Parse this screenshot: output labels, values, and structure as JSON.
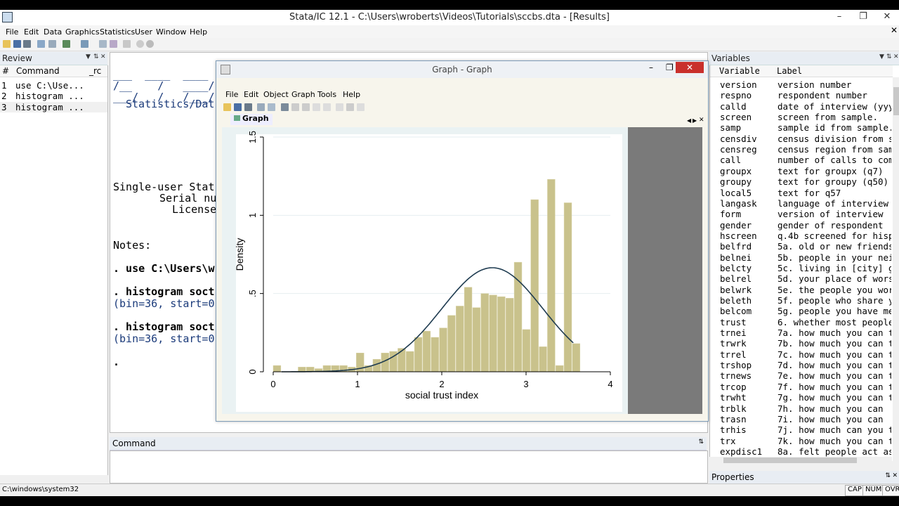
{
  "window": {
    "title": "Stata/IC 12.1 - C:\\Users\\wroberts\\Videos\\Tutorials\\sccbs.dta - [Results]"
  },
  "menu": [
    "File",
    "Edit",
    "Data",
    "Graphics",
    "Statistics",
    "User",
    "Window",
    "Help"
  ],
  "review": {
    "title": "Review",
    "columns": [
      "#",
      "Command",
      "_rc"
    ],
    "rows": [
      {
        "n": "1",
        "cmd": "use C:\\Use..."
      },
      {
        "n": "2",
        "cmd": "histogram ..."
      },
      {
        "n": "3",
        "cmd": "histogram ..."
      }
    ]
  },
  "results": {
    "logo1": "___  ____  ____",
    "logo2": "/__    /   ____/",
    "logo3": "___/   /   /___/",
    "stats_line": "Statistics/Dat",
    "single_user": "Single-user Stat",
    "serial": "Serial nu",
    "license": "License",
    "notes": "Notes:",
    "use_cmd": ". use C:\\Users\\w",
    "hist1": ". histogram soct",
    "bin1": "(bin=36, start=0",
    "hist2": ". histogram soct",
    "bin2": "(bin=36, start=0",
    "prompt": "."
  },
  "command": {
    "title": "Command"
  },
  "variables": {
    "title": "Variables",
    "columns": [
      "Variable",
      "Label"
    ],
    "rows": [
      {
        "name": "version",
        "label": "version number"
      },
      {
        "name": "respno",
        "label": "respondent number"
      },
      {
        "name": "calld",
        "label": "date of interview (yyy"
      },
      {
        "name": "screen",
        "label": "screen from sample."
      },
      {
        "name": "samp",
        "label": "sample id from sample."
      },
      {
        "name": "censdiv",
        "label": "census division from s"
      },
      {
        "name": "censreg",
        "label": "census region from sam"
      },
      {
        "name": "call",
        "label": "number of calls to com"
      },
      {
        "name": "groupx",
        "label": "text for groupx (q7)"
      },
      {
        "name": "groupy",
        "label": "text for groupy (q50)"
      },
      {
        "name": "local5",
        "label": "text for q57"
      },
      {
        "name": "langask",
        "label": "language of interview"
      },
      {
        "name": "form",
        "label": "version of interview"
      },
      {
        "name": "gender",
        "label": "gender of respondent"
      },
      {
        "name": "hscreen",
        "label": "q.4b screened for hisp"
      },
      {
        "name": "belfrd",
        "label": "5a. old or new friends"
      },
      {
        "name": "belnei",
        "label": "5b. people in your nei"
      },
      {
        "name": "belcty",
        "label": "5c. living in [city] g"
      },
      {
        "name": "belrel",
        "label": "5d. your place of wors"
      },
      {
        "name": "belwrk",
        "label": "5e. the people you wor"
      },
      {
        "name": "beleth",
        "label": "5f. people who share y"
      },
      {
        "name": "belcom",
        "label": "5g. people you have me"
      },
      {
        "name": "trust",
        "label": "6. whether most people"
      },
      {
        "name": "trnei",
        "label": "7a. how much you can t"
      },
      {
        "name": "trwrk",
        "label": "7b. how much you can t"
      },
      {
        "name": "trrel",
        "label": "7c. how much you can t"
      },
      {
        "name": "trshop",
        "label": "7d. how much you can t"
      },
      {
        "name": "trnews",
        "label": "7e. how much you can t"
      },
      {
        "name": "trcop",
        "label": "7f. how much you can t"
      },
      {
        "name": "trwht",
        "label": "7g. how much you can t"
      },
      {
        "name": "trblk",
        "label": "7h. how much  you can"
      },
      {
        "name": "trasn",
        "label": "7i. how much  you can"
      },
      {
        "name": "trhis",
        "label": "7j. how much can you t"
      },
      {
        "name": "trx",
        "label": "7k. how much you can t"
      },
      {
        "name": "expdisc1",
        "label": "8a. felt people act as"
      }
    ]
  },
  "properties": {
    "title": "Properties"
  },
  "status": {
    "path": "C:\\windows\\system32",
    "caps": "CAP",
    "num": "NUM",
    "ovr": "OVR"
  },
  "graph_window": {
    "title": "Graph - Graph",
    "menu": [
      "File",
      "Edit",
      "Object",
      "Graph",
      "Tools",
      "Help"
    ],
    "tab": "Graph"
  },
  "chart_data": {
    "type": "bar",
    "xlabel": "social trust index",
    "ylabel": "Density",
    "xlim": [
      0,
      4
    ],
    "ylim": [
      0,
      1.5
    ],
    "xticks": [
      "0",
      "1",
      "2",
      "3",
      "4"
    ],
    "yticks": [
      "0",
      ".5",
      "1",
      "1.5"
    ],
    "bin_start": 0,
    "bin_width": 0.0986,
    "values": [
      0.04,
      0,
      0,
      0.03,
      0.03,
      0.02,
      0.04,
      0.04,
      0.04,
      0.03,
      0.12,
      0.04,
      0.08,
      0.12,
      0.13,
      0.15,
      0.13,
      0.22,
      0.26,
      0.22,
      0.28,
      0.36,
      0.42,
      0.54,
      0.41,
      0.5,
      0.49,
      0.48,
      0.47,
      0.7,
      0.27,
      1.1,
      0.16,
      1.23,
      0.04,
      1.08,
      0.18
    ],
    "normal_curve": {
      "mean": 2.6,
      "sd": 0.6
    },
    "bar_color": "#c9c28c",
    "curve_color": "#1e3b50"
  }
}
